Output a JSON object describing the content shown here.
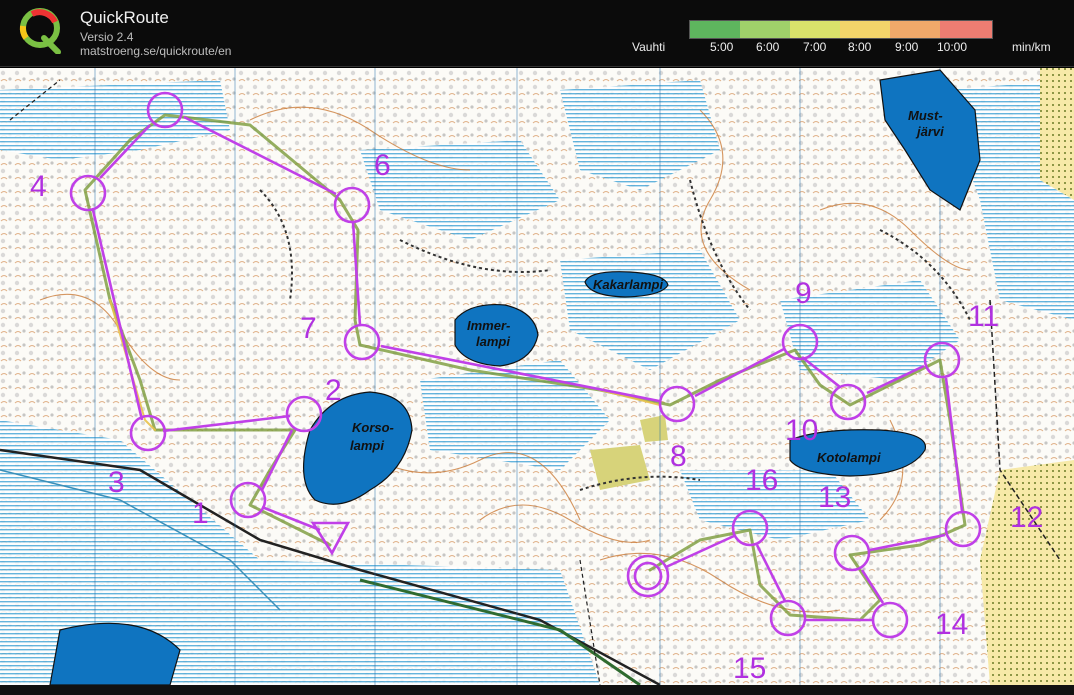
{
  "app": {
    "title": "QuickRoute",
    "version": "Versio 2.4",
    "url": "matstroeng.se/quickroute/en"
  },
  "legend": {
    "label": "Vauhti",
    "unit": "min/km",
    "ticks": [
      "5:00",
      "6:00",
      "7:00",
      "8:00",
      "9:00",
      "10:00"
    ],
    "gradient_colors": [
      "#5eb55e",
      "#9fd16a",
      "#d9e26b",
      "#f3d46a",
      "#f1a96a",
      "#ee7d72"
    ]
  },
  "map": {
    "lakes": [
      "Must-\njärvi",
      "Kakarlampi",
      "Immer-\nlampi",
      "Korso-\nlampi",
      "Kotolampi"
    ],
    "controls": [
      {
        "num": "1"
      },
      {
        "num": "2"
      },
      {
        "num": "3"
      },
      {
        "num": "4"
      },
      {
        "num": "6"
      },
      {
        "num": "7"
      },
      {
        "num": "8"
      },
      {
        "num": "9"
      },
      {
        "num": "10"
      },
      {
        "num": "11"
      },
      {
        "num": "12"
      },
      {
        "num": "13"
      },
      {
        "num": "14"
      },
      {
        "num": "15"
      },
      {
        "num": "16"
      }
    ],
    "course_color": "#c040e8",
    "route_color": "#7a9b3a",
    "water_color": "#0f74c0",
    "marsh_color": "#5fb3d9"
  }
}
